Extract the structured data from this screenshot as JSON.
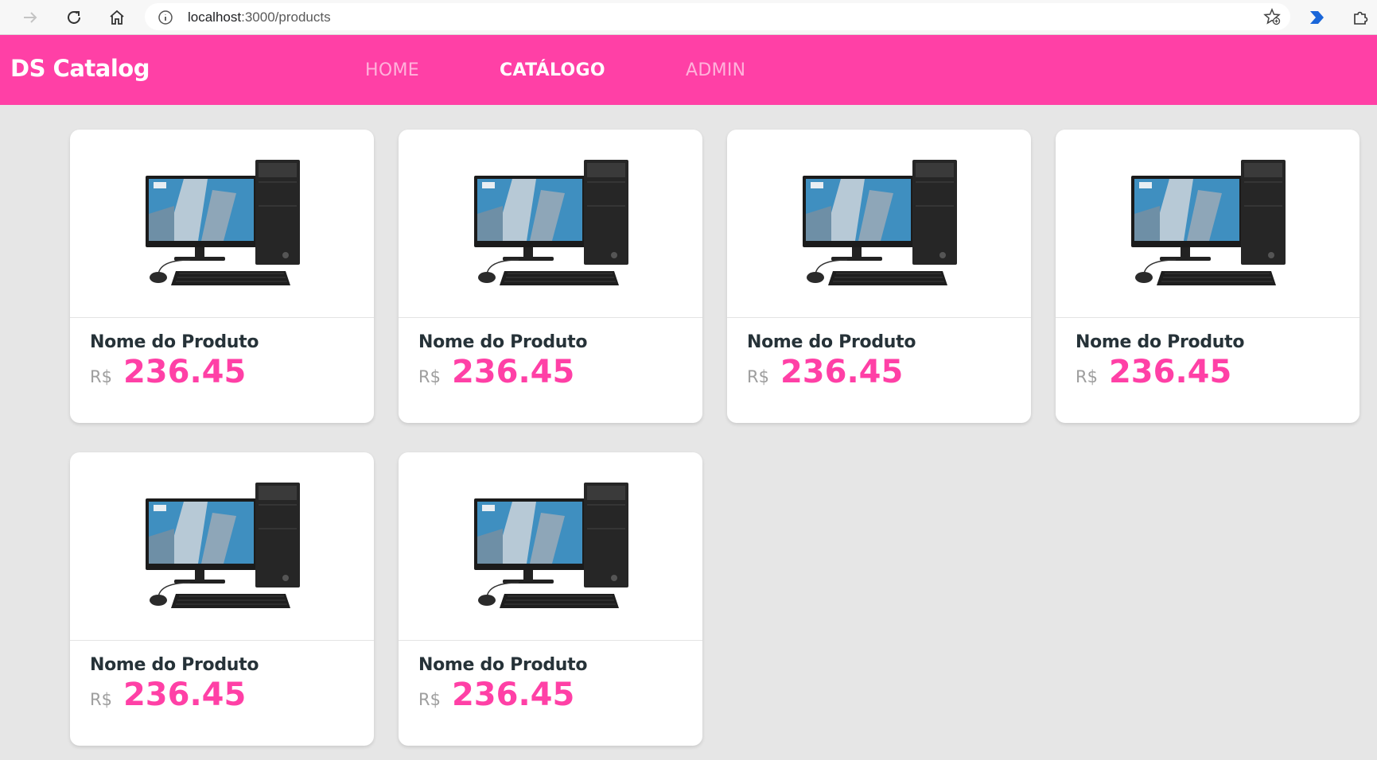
{
  "browser": {
    "url_host": "localhost",
    "url_path": ":3000/products"
  },
  "header": {
    "brand": "DS Catalog",
    "nav": [
      {
        "label": "HOME",
        "active": false
      },
      {
        "label": "CATÁLOGO",
        "active": true
      },
      {
        "label": "ADMIN",
        "active": false
      }
    ]
  },
  "products": [
    {
      "name": "Nome do Produto",
      "currency": "R$",
      "price": "236.45"
    },
    {
      "name": "Nome do Produto",
      "currency": "R$",
      "price": "236.45"
    },
    {
      "name": "Nome do Produto",
      "currency": "R$",
      "price": "236.45"
    },
    {
      "name": "Nome do Produto",
      "currency": "R$",
      "price": "236.45"
    },
    {
      "name": "Nome do Produto",
      "currency": "R$",
      "price": "236.45"
    },
    {
      "name": "Nome do Produto",
      "currency": "R$",
      "price": "236.45"
    }
  ],
  "icons": {
    "back": "arrow-right-icon",
    "reload": "reload-icon",
    "home": "home-icon",
    "info": "info-icon",
    "favorite": "star-add-icon",
    "extension": "puzzle-icon",
    "product_image": "desktop-computer-icon"
  },
  "colors": {
    "brand": "#ff40a6",
    "page_bg": "#e6e6e6",
    "text_dark": "#263238"
  }
}
